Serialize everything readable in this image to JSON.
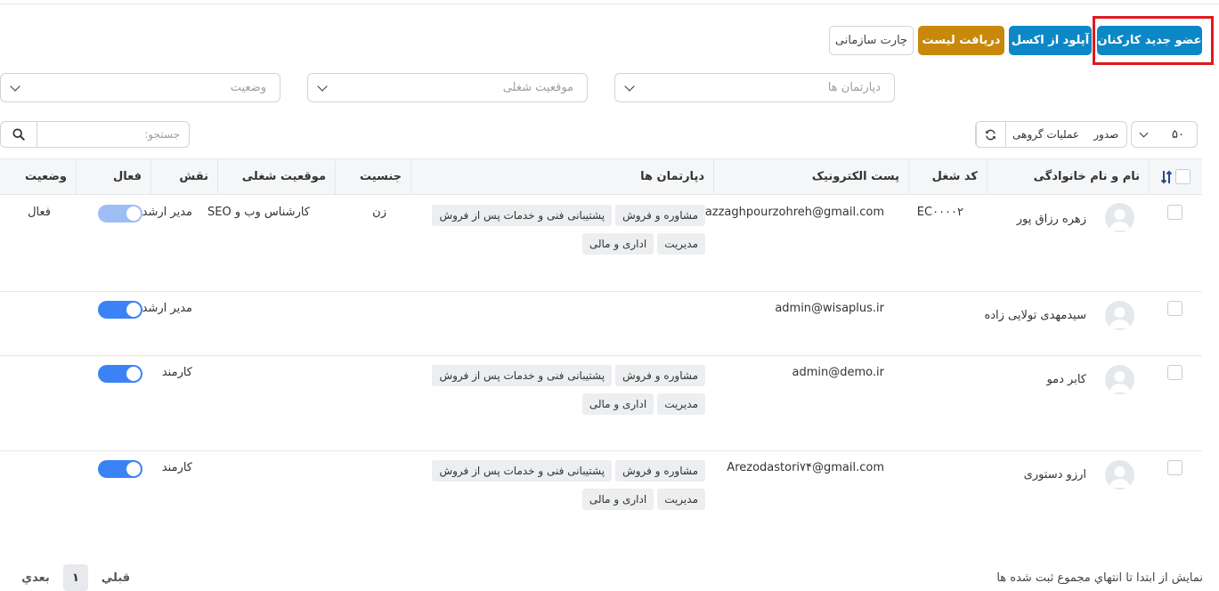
{
  "toolbar": {
    "new_member": "عضو جدید کارکنان",
    "upload_excel": "آپلود از اکسل",
    "download_list": "دریافت لیست",
    "org_chart": "چارت سازمانی"
  },
  "filters": {
    "departments": "دپارتمان ها",
    "job_position": "موقعیت شغلی",
    "status": "وضعیت"
  },
  "table_controls": {
    "per_page": "۵۰",
    "export": "صدور",
    "bulk_actions": "عملیات گروهی",
    "search_placeholder": "جستجو:"
  },
  "columns": {
    "name": "نام و نام خانوادگی",
    "job_code": "کد شغل",
    "email": "پست الکترونیک",
    "departments": "دپارتمان ها",
    "gender": "جنسیت",
    "job_position": "موقعیت شغلی",
    "role": "نقش",
    "active": "فعال",
    "status": "وضعیت"
  },
  "rows": [
    {
      "name": "زهره رزاق پور",
      "job_code": "EC۰۰۰۰۲",
      "email": "razzaghpourzohreh@gmail.com",
      "tags": [
        "مشاوره و فروش",
        "پشتیبانی فنی و خدمات پس از فروش",
        "مدیریت",
        "اداری و مالی"
      ],
      "gender": "زن",
      "job_position": "کارشناس وب و SEO",
      "role": "مدیر ارشد",
      "active": true,
      "status": "فعال"
    },
    {
      "name": "سیدمهدی تولایی زاده",
      "job_code": "",
      "email": "admin@wisaplus.ir",
      "tags": [],
      "gender": "",
      "job_position": "",
      "role": "مدیر ارشد",
      "active": true,
      "status": ""
    },
    {
      "name": "کابر دمو",
      "job_code": "",
      "email": "admin@demo.ir",
      "tags": [
        "مشاوره و فروش",
        "پشتیبانی فنی و خدمات پس از فروش",
        "مدیریت",
        "اداری و مالی"
      ],
      "gender": "",
      "job_position": "",
      "role": "کارمند",
      "active": true,
      "status": ""
    },
    {
      "name": "ارزو دستوری",
      "job_code": "",
      "email": "Arezodastori۷۴@gmail.com",
      "tags": [
        "مشاوره و فروش",
        "پشتیبانی فنی و خدمات پس از فروش",
        "مدیریت",
        "اداری و مالی"
      ],
      "gender": "",
      "job_position": "",
      "role": "کارمند",
      "active": true,
      "status": ""
    }
  ],
  "footer": {
    "info": "نمایش از ابتدا تا انتهاي مجموع ثبت شده ها",
    "prev": "قبلي",
    "page": "۱",
    "next": "بعدي"
  },
  "colors": {
    "primary": "#0d88c6",
    "warning": "#c8890a",
    "toggle_on": "#3b82f6",
    "toggle_light": "#9fbdf5",
    "highlight": "#e0191f"
  }
}
